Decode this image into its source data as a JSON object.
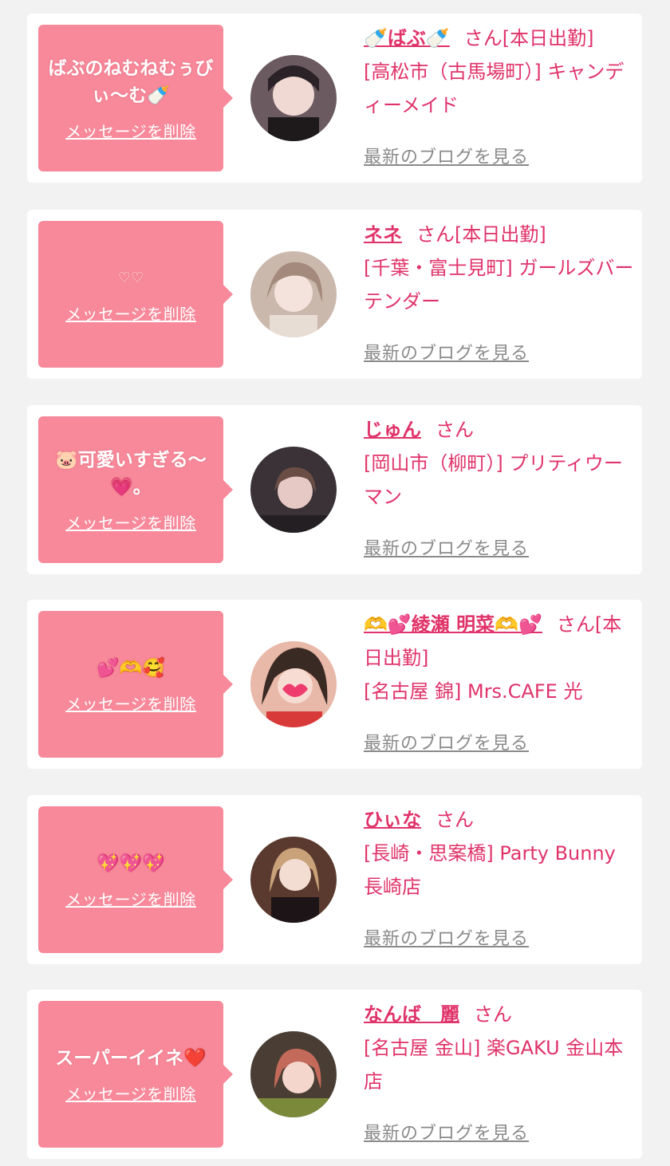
{
  "colors": {
    "accent": "#e0336a",
    "bubble": "#f7899a",
    "link_gray": "#8a8a8a",
    "background": "#f2f2f2"
  },
  "cards": [
    {
      "message": "ばぶのねむねむぅびぃ〜む🍼",
      "delete": "メッセージを削除",
      "name": "🍼ばぶ🍼",
      "san": "さん",
      "status": "[本日出勤]",
      "shop": "[高松市（古馬場町）] キャンディーメイド",
      "blog": "最新のブログを見る",
      "avatar_color": "#6b5a60"
    },
    {
      "message": "♡♡",
      "delete": "メッセージを削除",
      "name": "ネネ",
      "san": "さん",
      "status": "[本日出勤]",
      "shop": "[千葉・富士見町] ガールズバー テンダー",
      "blog": "最新のブログを見る",
      "avatar_color": "#cbb8ad"
    },
    {
      "message": "🐷可愛いすぎる〜💗。",
      "delete": "メッセージを削除",
      "name": "じゅん",
      "san": "さん",
      "status": "",
      "shop": "[岡山市（柳町）] プリティウーマン",
      "blog": "最新のブログを見る",
      "avatar_color": "#3a3236"
    },
    {
      "message": "💕🫶🥰",
      "delete": "メッセージを削除",
      "name": "🫶💕綾瀬 明菜🫶💕",
      "san": "さん",
      "status": "[本日出勤]",
      "shop": "[名古屋 錦] Mrs.CAFE 光",
      "blog": "最新のブログを見る",
      "avatar_color": "#e8b8a8"
    },
    {
      "message": "💖💖💖",
      "delete": "メッセージを削除",
      "name": "ひぃな",
      "san": "さん",
      "status": "",
      "shop": "[長崎・思案橋] Party Bunny 長崎店",
      "blog": "最新のブログを見る",
      "avatar_color": "#5a3a2e"
    },
    {
      "message": "スーパーイイネ❤️",
      "delete": "メッセージを削除",
      "name": "なんば　麗",
      "san": "さん",
      "status": "",
      "shop": "[名古屋 金山] 楽GAKU 金山本店",
      "blog": "最新のブログを見る",
      "avatar_color": "#4a3e34"
    }
  ]
}
